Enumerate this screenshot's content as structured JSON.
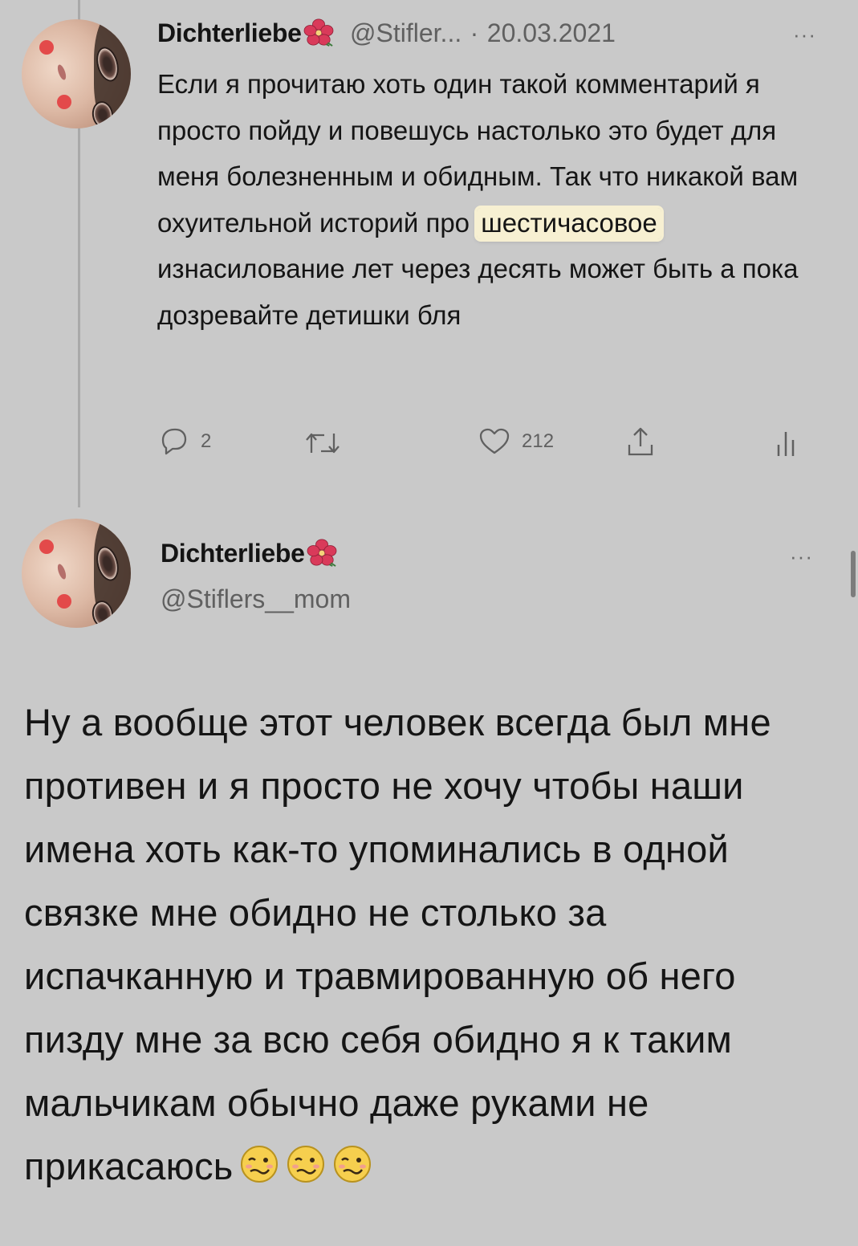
{
  "tweet1": {
    "display_name": "Dichterliebe",
    "handle": "@Stifler...",
    "separator": "·",
    "date": "20.03.2021",
    "more_label": "···",
    "text_before": "Если я прочитаю хоть один такой комментарий я просто пойду и повешусь настолько это будет для меня болезненным и обидным. Так что никакой вам охуительной историй про ",
    "text_highlight": "шестичасовое",
    "text_after": " изнасилование лет через десять может быть а пока дозревайте детишки бля",
    "replies_count": "2",
    "retweets_count": "",
    "likes_count": "212"
  },
  "tweet2": {
    "display_name": "Dichterliebe",
    "handle": "@Stiflers__mom",
    "more_label": "···",
    "text": "Ну а вообще этот человек всегда был мне противен и я просто не хочу чтобы наши имена хоть как-то упоминались в одной связке мне обидно не столько за испачканную и травмированную об него пизду мне за всю себя обидно я к таким мальчикам обычно даже руками не прикасаюсь"
  },
  "icons": {
    "reply": "reply-icon",
    "retweet": "retweet-icon",
    "like": "heart-icon",
    "share": "share-icon",
    "analytics": "analytics-icon",
    "flower": "hibiscus-flower-icon",
    "emoji": "woozy-face-emoji"
  },
  "colors": {
    "background": "#c9c9c9",
    "text": "#151515",
    "secondary": "#606060",
    "highlight": "#f7f0d2"
  }
}
